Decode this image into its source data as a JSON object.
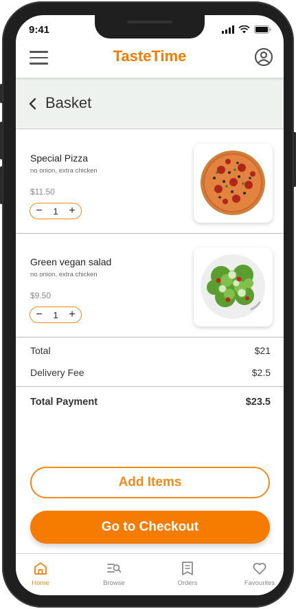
{
  "status_bar": {
    "time": "9:41"
  },
  "header": {
    "brand": "TasteTime",
    "menu_icon": "hamburger-menu-icon",
    "profile_icon": "user-profile-icon"
  },
  "page": {
    "title": "Basket",
    "back_icon": "chevron-left-icon"
  },
  "items": [
    {
      "name": "Special Pizza",
      "note": "no onion, extra chicken",
      "price": "$11.50",
      "quantity": "1",
      "minus": "−",
      "plus": "+",
      "image": "pizza"
    },
    {
      "name": "Green vegan salad",
      "note": "no onion, extra chicken",
      "price": "$9.50",
      "quantity": "1",
      "minus": "−",
      "plus": "+",
      "image": "salad"
    }
  ],
  "summary": {
    "total_label": "Total",
    "total_value": "$21",
    "delivery_label": "Delivery Fee",
    "delivery_value": "$2.5",
    "payment_label": "Total Payment",
    "payment_value": "$23.5"
  },
  "actions": {
    "add_items": "Add Items",
    "checkout": "Go to Checkout"
  },
  "nav": [
    {
      "label": "Home",
      "icon": "home-icon",
      "active": true
    },
    {
      "label": "Browse",
      "icon": "browse-icon",
      "active": false
    },
    {
      "label": "Orders",
      "icon": "orders-icon",
      "active": false
    },
    {
      "label": "Favourites",
      "icon": "heart-icon",
      "active": false
    }
  ],
  "colors": {
    "accent": "#f57c00",
    "accent_border": "#f08a1c",
    "title_band": "#eef2ef"
  }
}
